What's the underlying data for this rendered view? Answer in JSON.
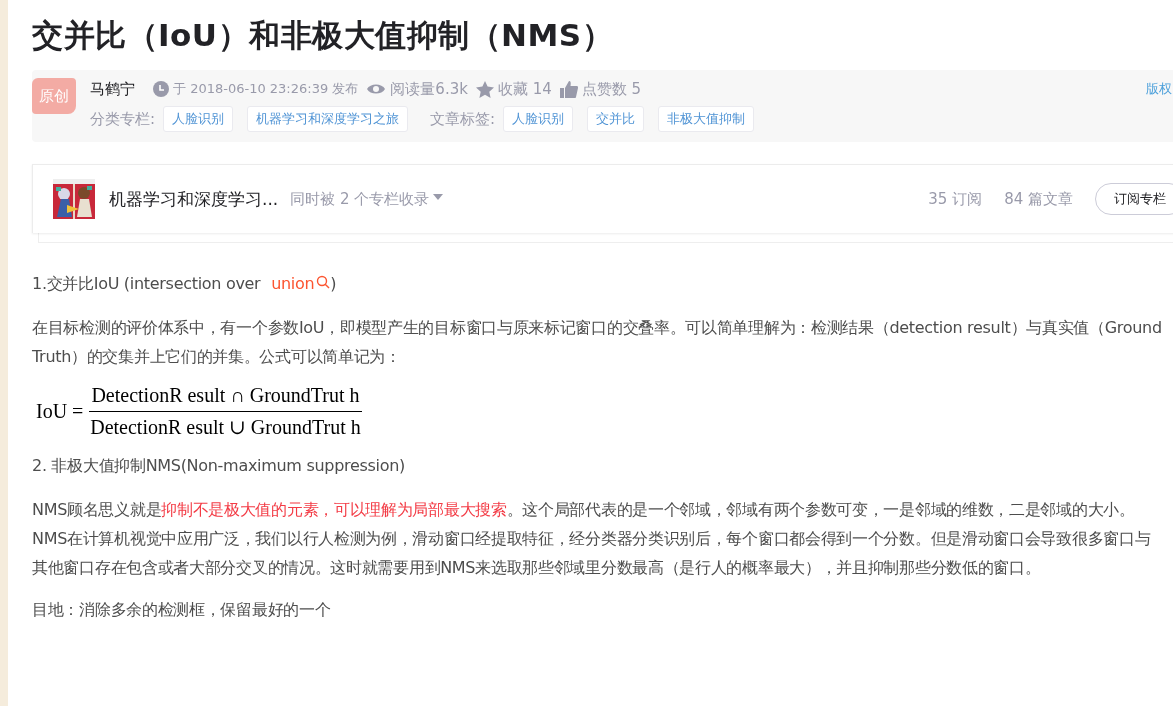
{
  "title": "交并比（IoU）和非极大值抑制（NMS）",
  "meta": {
    "badge": "原创",
    "author": "马鹤宁",
    "date": "于 2018-06-10 23:26:39 发布",
    "views": "阅读量6.3k",
    "favorites": "收藏 14",
    "likes": "点赞数 5",
    "copyright": "版权",
    "category_label": "分类专栏:",
    "categories": [
      "人脸识别",
      "机器学习和深度学习之旅"
    ],
    "tag_label": "文章标签:",
    "tags": [
      "人脸识别",
      "交并比",
      "非极大值抑制"
    ]
  },
  "column": {
    "name": "机器学习和深度学习...",
    "included": "同时被 2 个专栏收录",
    "subscribers": "35 订阅",
    "articles": "84 篇文章",
    "subscribe_button": "订阅专栏"
  },
  "content": [
    {
      "kind": "heading",
      "segments": [
        {
          "text": "1.交并比IoU (intersection over ",
          "link": false
        },
        {
          "text": "union",
          "link": true
        },
        {
          "text": ")",
          "link": false
        }
      ]
    },
    {
      "kind": "paragraph",
      "segments": [
        {
          "text": "在目标检测的评价体系中，有一个参数IoU，即模型产生的目标窗口与原来标记窗口的交叠率。可以简单理解为：检测结果（detection result）与真实值（Ground Truth）的交集并上它们的并集。公式可以简单记为：",
          "highlight": false
        }
      ]
    },
    {
      "kind": "formula",
      "lhs": "IoU =",
      "numerator": "DetectionR esult ∩ GroundTrut h",
      "denominator": "DetectionR esult ∪ GroundTrut h"
    },
    {
      "kind": "heading",
      "segments": [
        {
          "text": "2. 非极大值抑制NMS(Non-maximum suppression)",
          "link": false
        }
      ]
    },
    {
      "kind": "paragraph",
      "segments": [
        {
          "text": "NMS顾名思义就是",
          "highlight": false
        },
        {
          "text": "抑制不是极大值的元素，可以理解为局部最大搜索",
          "highlight": true
        },
        {
          "text": "。这个局部代表的是一个邻域，邻域有两个参数可变，一是邻域的维数，二是邻域的大小。NMS在计算机视觉中应用广泛，我们以行人检测为例，滑动窗口经提取特征，经分类器分类识别后，每个窗口都会得到一个分数。但是滑动窗口会导致很多窗口与其他窗口存在包含或者大部分交叉的情况。这时就需要用到NMS来选取那些邻域里分数最高（是行人的概率最大），并且抑制那些分数低的窗口。",
          "highlight": false
        }
      ]
    },
    {
      "kind": "paragraph",
      "segments": [
        {
          "text": "目地：消除多余的检测框，保留最好的一个",
          "highlight": false
        }
      ]
    }
  ]
}
